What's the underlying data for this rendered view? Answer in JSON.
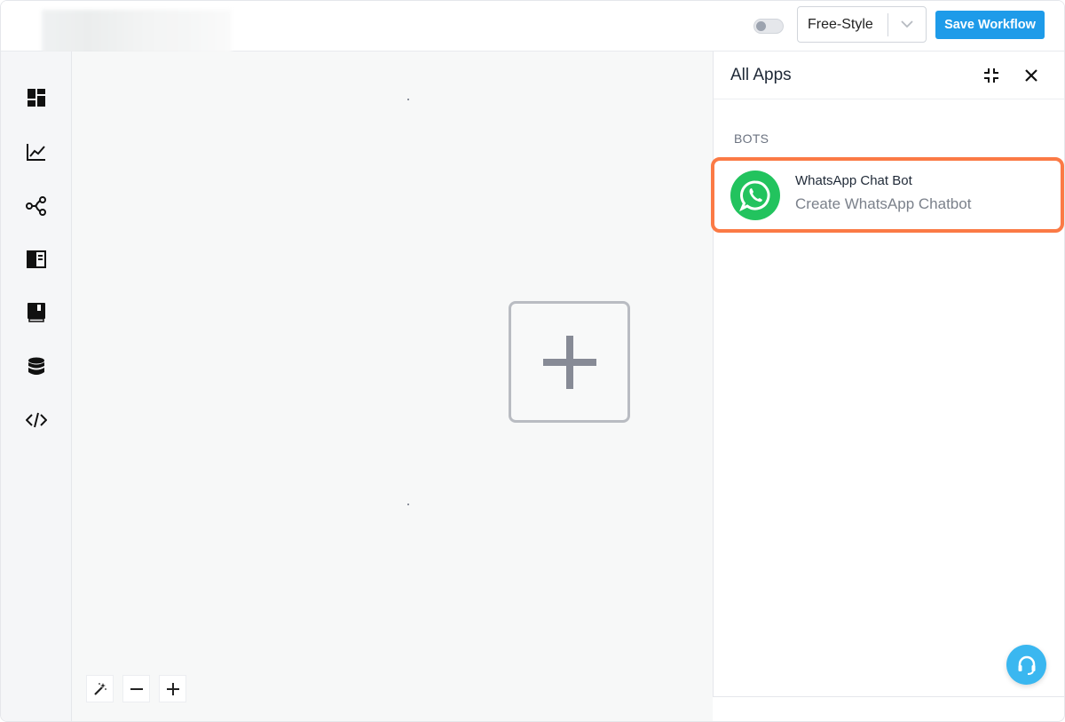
{
  "header": {
    "mode_select": {
      "value": "Free-Style"
    },
    "save_label": "Save Workflow"
  },
  "sidebar": {
    "items": [
      {
        "icon": "dashboard-icon"
      },
      {
        "icon": "analytics-chart-icon"
      },
      {
        "icon": "workflow-share-icon"
      },
      {
        "icon": "layout-panel-icon"
      },
      {
        "icon": "book-icon"
      },
      {
        "icon": "database-icon"
      },
      {
        "icon": "code-icon"
      }
    ]
  },
  "canvas": {
    "zoom_controls": [
      {
        "icon": "magic-wand-icon"
      },
      {
        "icon": "minus-icon"
      },
      {
        "icon": "plus-icon"
      }
    ]
  },
  "panel": {
    "title": "All Apps",
    "section_label": "BOTS",
    "apps": [
      {
        "name": "WhatsApp Chat Bot",
        "description": "Create WhatsApp Chatbot",
        "icon": "whatsapp-icon"
      }
    ]
  },
  "colors": {
    "accent": "#1e9be9",
    "highlight": "#fb7a45",
    "whatsapp": "#22c35e",
    "help": "#3ab7f0"
  }
}
